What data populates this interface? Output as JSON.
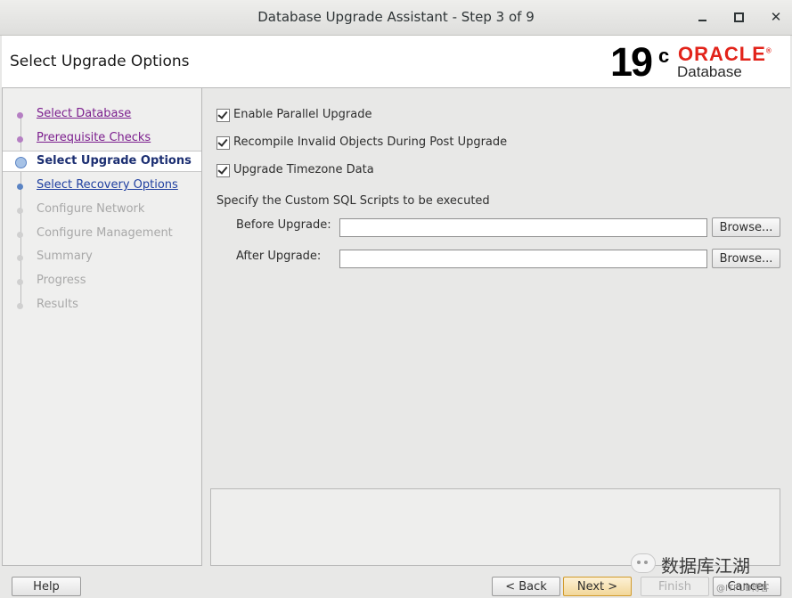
{
  "window": {
    "title": "Database Upgrade Assistant - Step 3 of 9",
    "controls": [
      "minimize",
      "maximize",
      "close"
    ]
  },
  "header": {
    "title": "Select Upgrade Options",
    "logo": {
      "version": "19",
      "superscript": "c",
      "brand": "ORACLE",
      "brand_mark": "®",
      "product": "Database",
      "brand_color": "#e2231a"
    }
  },
  "sidebar": {
    "steps": [
      {
        "label": "Select Database",
        "state": "visited"
      },
      {
        "label": "Prerequisite Checks",
        "state": "visited"
      },
      {
        "label": "Select Upgrade Options",
        "state": "current"
      },
      {
        "label": "Select Recovery Options",
        "state": "link"
      },
      {
        "label": "Configure Network",
        "state": "disabled"
      },
      {
        "label": "Configure Management",
        "state": "disabled"
      },
      {
        "label": "Summary",
        "state": "disabled"
      },
      {
        "label": "Progress",
        "state": "disabled"
      },
      {
        "label": "Results",
        "state": "disabled"
      }
    ]
  },
  "options": {
    "parallel": {
      "label": "Enable Parallel Upgrade",
      "checked": true
    },
    "recompile": {
      "label": "Recompile Invalid Objects During Post Upgrade",
      "checked": true
    },
    "timezone": {
      "label": "Upgrade Timezone Data",
      "checked": true
    }
  },
  "sql_scripts": {
    "heading": "Specify the Custom SQL Scripts to be executed",
    "before": {
      "label": "Before Upgrade:",
      "value": ""
    },
    "after": {
      "label": "After Upgrade:",
      "value": ""
    },
    "browse_label": "Browse..."
  },
  "footer": {
    "help": "Help",
    "back": "< Back",
    "next": "Next >",
    "finish": "Finish",
    "cancel": "Cancel"
  },
  "watermark": {
    "text": "数据库江湖",
    "sub": "@ITPUB博客"
  }
}
